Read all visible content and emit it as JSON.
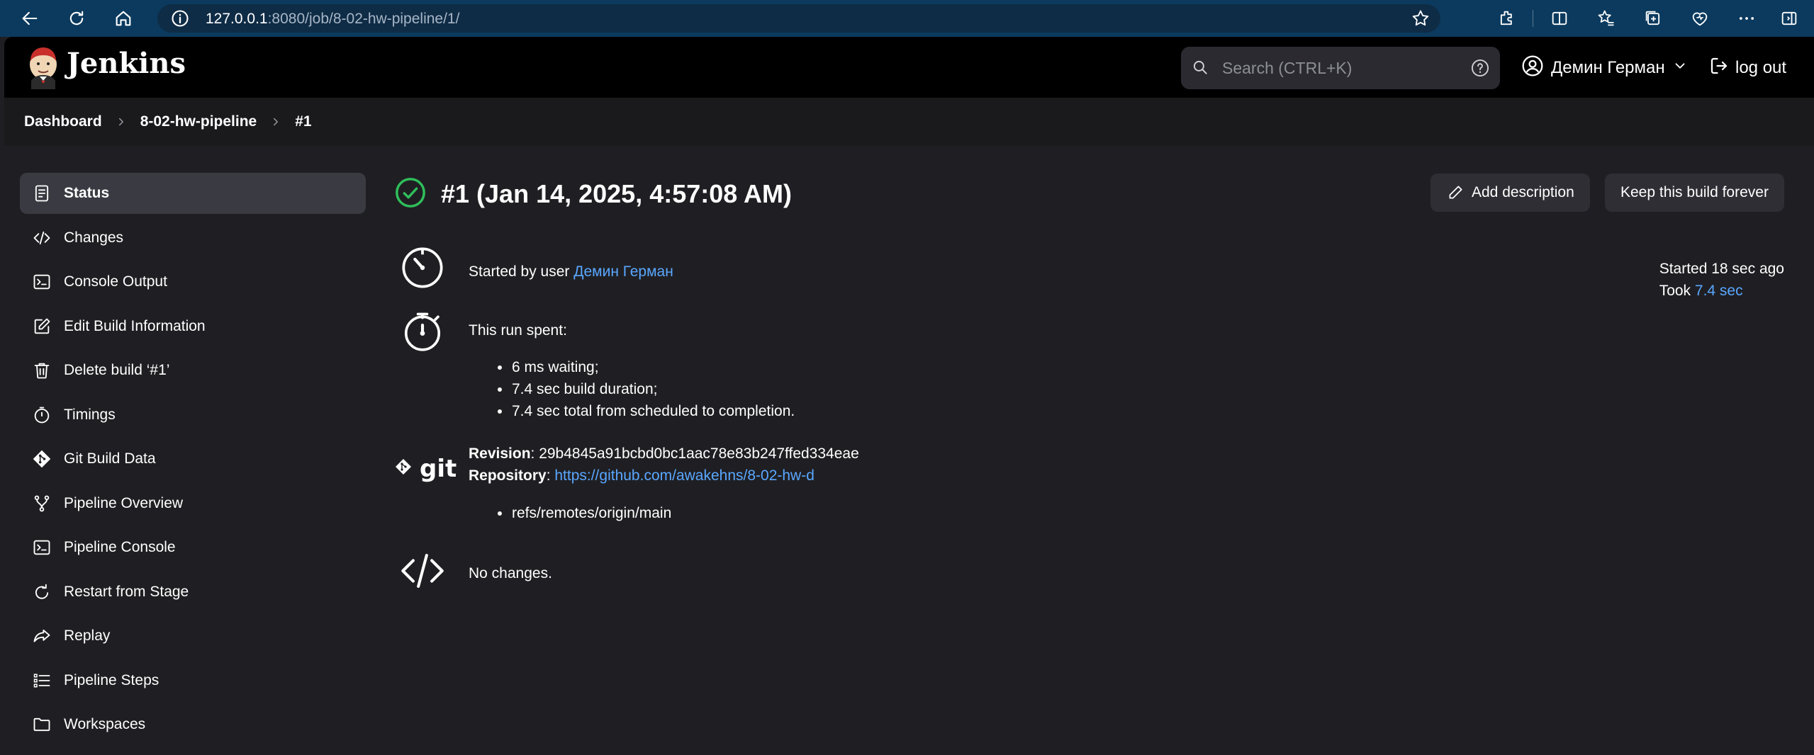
{
  "browser": {
    "url_host": "127.0.0.1",
    "url_rest": ":8080/job/8-02-hw-pipeline/1/"
  },
  "header": {
    "brand": "Jenkins",
    "search_placeholder": "Search (CTRL+K)",
    "user_name": "Демин Герман",
    "logout_label": "log out"
  },
  "breadcrumb": [
    "Dashboard",
    "8-02-hw-pipeline",
    "#1"
  ],
  "sidebar": {
    "items": [
      {
        "label": "Status",
        "icon": "status-icon"
      },
      {
        "label": "Changes",
        "icon": "code-icon"
      },
      {
        "label": "Console Output",
        "icon": "terminal-icon"
      },
      {
        "label": "Edit Build Information",
        "icon": "edit-icon"
      },
      {
        "label": "Delete build ‘#1’",
        "icon": "trash-icon"
      },
      {
        "label": "Timings",
        "icon": "stopwatch-icon"
      },
      {
        "label": "Git Build Data",
        "icon": "git-icon"
      },
      {
        "label": "Pipeline Overview",
        "icon": "branch-icon"
      },
      {
        "label": "Pipeline Console",
        "icon": "terminal-icon"
      },
      {
        "label": "Restart from Stage",
        "icon": "restart-icon"
      },
      {
        "label": "Replay",
        "icon": "replay-icon"
      },
      {
        "label": "Pipeline Steps",
        "icon": "list-icon"
      },
      {
        "label": "Workspaces",
        "icon": "folder-icon"
      }
    ]
  },
  "build": {
    "title": "#1 (Jan 14, 2025, 4:57:08 AM)",
    "add_description_label": "Add description",
    "keep_forever_label": "Keep this build forever",
    "started_by_prefix": "Started by user ",
    "started_by_user": "Демин Герман",
    "run_spent_label": "This run spent:",
    "run_spent": [
      "6 ms waiting;",
      "7.4 sec build duration;",
      "7.4 sec total from scheduled to completion."
    ],
    "git_label": "git",
    "revision_label": "Revision",
    "revision_value": ": 29b4845a91bcbd0bc1aac78e83b247ffed334eae",
    "repository_label": "Repository",
    "repository_sep": ": ",
    "repository_url": "https://github.com/awakehns/8-02-hw-d",
    "refs": [
      "refs/remotes/origin/main"
    ],
    "no_changes": "No changes.",
    "started_ago": "Started 18 sec ago",
    "took_label": "Took ",
    "took_value": "7.4 sec"
  },
  "colors": {
    "success": "#2fbf5b",
    "link": "#5aa7ff",
    "browser_chrome": "#0b3a5e"
  }
}
